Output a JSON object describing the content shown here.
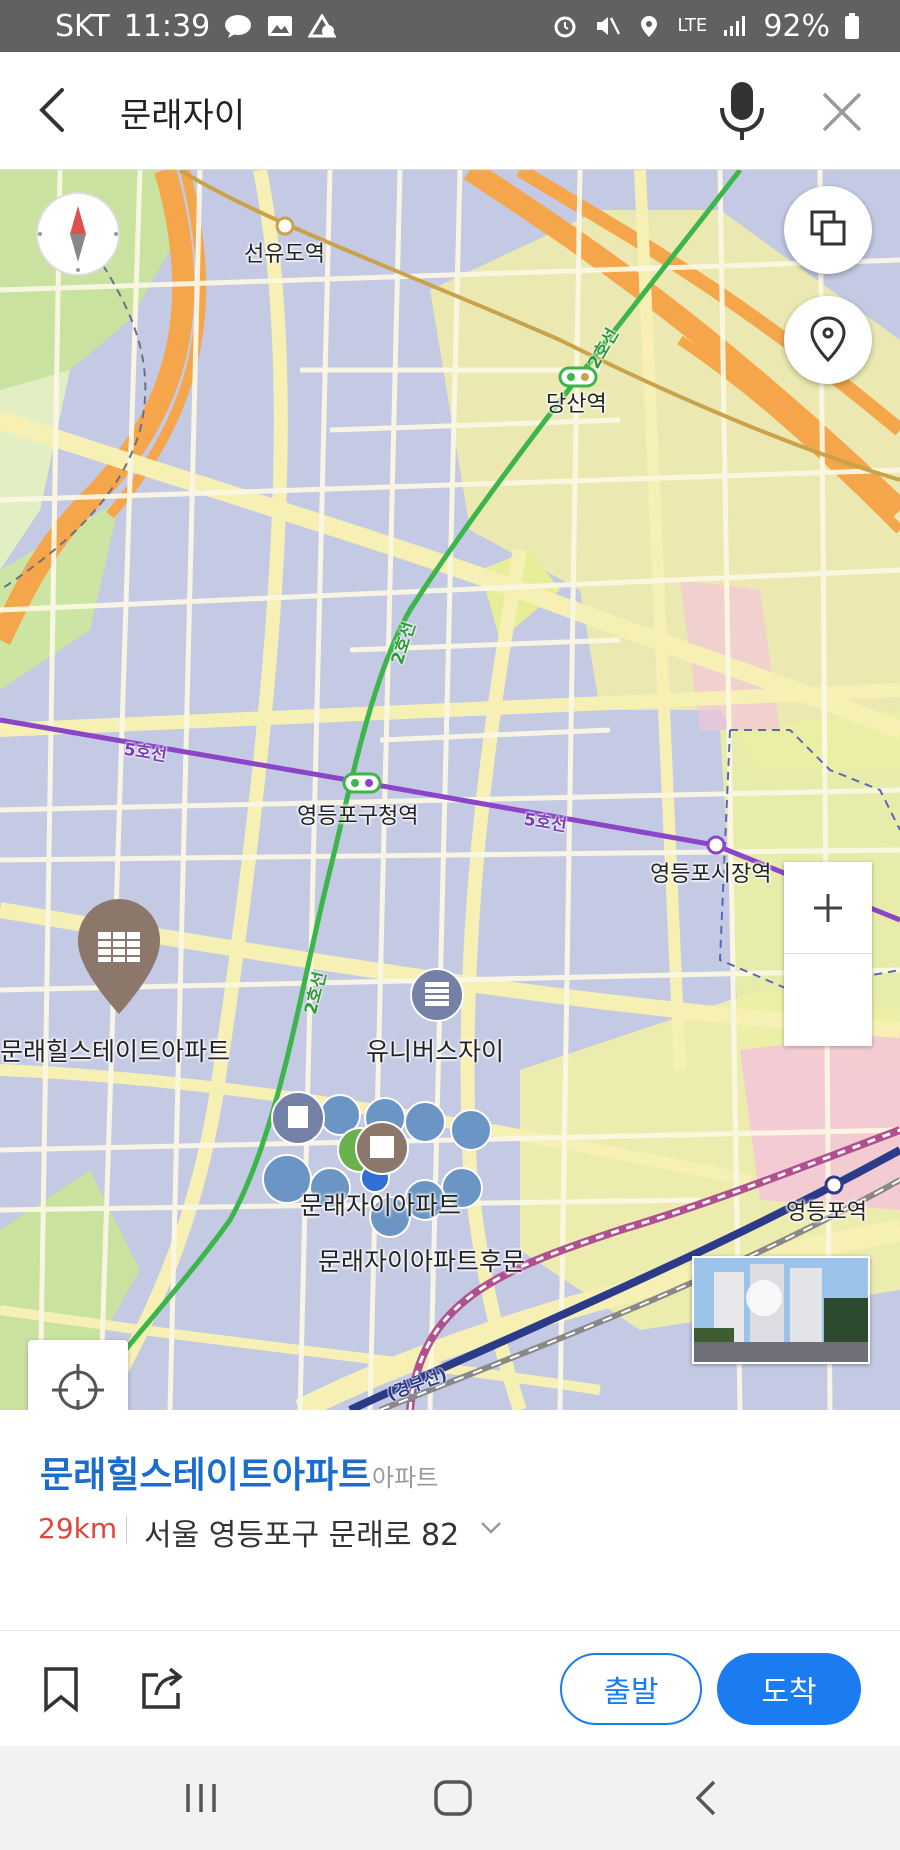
{
  "status_bar": {
    "carrier": "SKT",
    "time": "11:39",
    "network": "LTE",
    "battery": "92%"
  },
  "search": {
    "query": "문래자이"
  },
  "map": {
    "station_labels": [
      "선유도역",
      "당산역",
      "영등포구청역",
      "영등포시장역",
      "영등포역"
    ],
    "line_labels": [
      "5호선",
      "5호선",
      "2호선",
      "2호선",
      "2호선",
      "(경부선)"
    ],
    "poi_labels": [
      "문래힐스테이트아파트",
      "유니버스자이",
      "문래자이아파트",
      "문래자이아파트후문"
    ],
    "compass_letter": "N",
    "colors": {
      "line2": "#3cb54a",
      "line5": "#8b45c6",
      "expressway": "#f5a54a",
      "park": "#c9e2a0",
      "selected_pin": "#8c786a"
    }
  },
  "place": {
    "name": "문래힐스테이트아파트",
    "category": "아파트",
    "distance": "29km",
    "address": "서울 영등포구 문래로 82"
  },
  "actions": {
    "depart_label": "출발",
    "arrive_label": "도착"
  }
}
